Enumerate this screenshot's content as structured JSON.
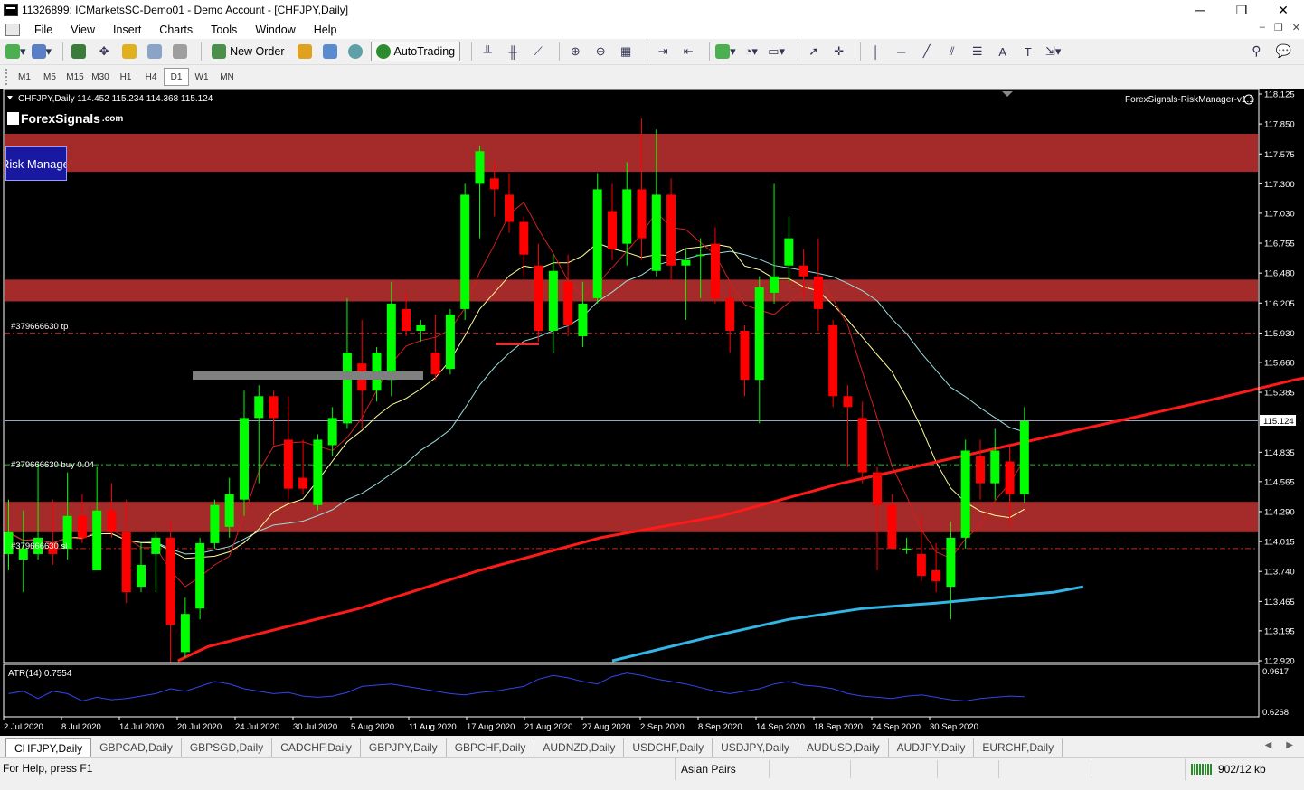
{
  "window": {
    "title": "11326899: ICMarketsSC-Demo01 - Demo Account - [CHFJPY,Daily]",
    "minimize": "─",
    "maximize": "❐",
    "close": "✕"
  },
  "menu": {
    "items": [
      "File",
      "View",
      "Insert",
      "Charts",
      "Tools",
      "Window",
      "Help"
    ],
    "mdi_minimize": "–",
    "mdi_restore": "❐",
    "mdi_close": "✕"
  },
  "toolbar": {
    "new_order_label": "New Order",
    "autotrading_label": "AutoTrading"
  },
  "timeframes": {
    "items": [
      "M1",
      "M5",
      "M15",
      "M30",
      "H1",
      "H4",
      "D1",
      "W1",
      "MN"
    ],
    "active": "D1"
  },
  "chart": {
    "header": "CHFJPY,Daily  114.452 115.234 114.368 115.124",
    "indicator_label": "ForexSignals-RiskManager-v1.1",
    "logo_text": "ForexSignals",
    "logo_suffix": ".com",
    "risk_manager_button": "Risk Manager",
    "tp_label": "#379666630 tp",
    "buy_label": "#379666630 buy 0.04",
    "sl_label": "#379666630 sl",
    "current_price": "115.124",
    "atr_label": "ATR(14) 0.7554",
    "colors": {
      "bull": "#00ff00",
      "bear": "#ff0000",
      "zone": "#a52a2a",
      "ma_slow": "#ff1a1a",
      "ma_200": "#33b5e5",
      "ma_fast_yellow": "#ffff99",
      "ma_mid_cyan": "#99dddd"
    }
  },
  "chart_data": {
    "type": "candlestick",
    "symbol": "CHFJPY",
    "timeframe": "Daily",
    "price_axis": [
      "118.125",
      "117.850",
      "117.575",
      "117.300",
      "117.030",
      "116.755",
      "116.480",
      "116.205",
      "115.930",
      "115.660",
      "115.385",
      "115.124",
      "114.835",
      "114.565",
      "114.290",
      "114.015",
      "113.740",
      "113.465",
      "113.195",
      "112.920"
    ],
    "atr_axis": [
      "0.9617",
      "0.6268"
    ],
    "date_axis": [
      "2 Jul 2020",
      "8 Jul 2020",
      "14 Jul 2020",
      "20 Jul 2020",
      "24 Jul 2020",
      "30 Jul 2020",
      "5 Aug 2020",
      "11 Aug 2020",
      "17 Aug 2020",
      "21 Aug 2020",
      "27 Aug 2020",
      "2 Sep 2020",
      "8 Sep 2020",
      "14 Sep 2020",
      "18 Sep 2020",
      "24 Sep 2020",
      "30 Sep 2020"
    ],
    "levels": {
      "tp": 115.93,
      "buy": 114.72,
      "sl": 113.95,
      "current": 115.124
    },
    "zones": [
      {
        "from": 117.41,
        "to": 117.76
      },
      {
        "from": 116.22,
        "to": 116.42
      },
      {
        "from": 114.1,
        "to": 114.38
      }
    ],
    "candles": [
      {
        "o": 113.9,
        "h": 114.4,
        "l": 113.75,
        "c": 114.1
      },
      {
        "o": 113.85,
        "h": 114.3,
        "l": 113.55,
        "c": 113.95
      },
      {
        "o": 113.9,
        "h": 114.75,
        "l": 113.85,
        "c": 114.05
      },
      {
        "o": 114.0,
        "h": 114.4,
        "l": 113.8,
        "c": 113.9
      },
      {
        "o": 113.95,
        "h": 114.65,
        "l": 113.85,
        "c": 114.25
      },
      {
        "o": 114.25,
        "h": 114.45,
        "l": 114.0,
        "c": 114.05
      },
      {
        "o": 113.75,
        "h": 114.7,
        "l": 113.8,
        "c": 114.3
      },
      {
        "o": 114.3,
        "h": 114.55,
        "l": 114.05,
        "c": 114.1
      },
      {
        "o": 114.1,
        "h": 114.4,
        "l": 113.45,
        "c": 113.55
      },
      {
        "o": 113.6,
        "h": 114.0,
        "l": 113.55,
        "c": 113.8
      },
      {
        "o": 113.9,
        "h": 114.1,
        "l": 113.55,
        "c": 114.05
      },
      {
        "o": 114.05,
        "h": 114.2,
        "l": 112.9,
        "c": 113.25
      },
      {
        "o": 113.0,
        "h": 113.5,
        "l": 112.95,
        "c": 113.35
      },
      {
        "o": 113.4,
        "h": 114.05,
        "l": 113.3,
        "c": 114.0
      },
      {
        "o": 114.0,
        "h": 114.4,
        "l": 113.95,
        "c": 114.35
      },
      {
        "o": 114.15,
        "h": 114.6,
        "l": 114.05,
        "c": 114.45
      },
      {
        "o": 114.4,
        "h": 115.4,
        "l": 114.25,
        "c": 115.15
      },
      {
        "o": 115.15,
        "h": 115.45,
        "l": 114.55,
        "c": 115.35
      },
      {
        "o": 115.35,
        "h": 115.4,
        "l": 114.9,
        "c": 115.15
      },
      {
        "o": 114.95,
        "h": 115.35,
        "l": 114.4,
        "c": 114.5
      },
      {
        "o": 114.6,
        "h": 114.95,
        "l": 114.45,
        "c": 114.5
      },
      {
        "o": 114.35,
        "h": 115.0,
        "l": 114.3,
        "c": 114.95
      },
      {
        "o": 114.9,
        "h": 115.25,
        "l": 114.8,
        "c": 115.15
      },
      {
        "o": 115.1,
        "h": 116.25,
        "l": 115.05,
        "c": 115.75
      },
      {
        "o": 115.65,
        "h": 116.05,
        "l": 115.05,
        "c": 115.4
      },
      {
        "o": 115.4,
        "h": 115.8,
        "l": 115.3,
        "c": 115.75
      },
      {
        "o": 115.5,
        "h": 116.4,
        "l": 115.35,
        "c": 116.2
      },
      {
        "o": 116.15,
        "h": 116.3,
        "l": 115.9,
        "c": 115.95
      },
      {
        "o": 115.95,
        "h": 116.05,
        "l": 115.85,
        "c": 116.0
      },
      {
        "o": 115.75,
        "h": 116.1,
        "l": 115.5,
        "c": 115.55
      },
      {
        "o": 115.6,
        "h": 116.15,
        "l": 115.55,
        "c": 116.1
      },
      {
        "o": 116.15,
        "h": 117.3,
        "l": 116.05,
        "c": 117.2
      },
      {
        "o": 117.3,
        "h": 117.65,
        "l": 116.8,
        "c": 117.6
      },
      {
        "o": 117.35,
        "h": 117.5,
        "l": 117.0,
        "c": 117.25
      },
      {
        "o": 117.2,
        "h": 117.4,
        "l": 116.85,
        "c": 116.95
      },
      {
        "o": 116.95,
        "h": 117.0,
        "l": 116.45,
        "c": 116.65
      },
      {
        "o": 116.55,
        "h": 116.75,
        "l": 115.85,
        "c": 115.95
      },
      {
        "o": 115.95,
        "h": 116.65,
        "l": 115.75,
        "c": 116.5
      },
      {
        "o": 116.4,
        "h": 116.65,
        "l": 115.9,
        "c": 116.0
      },
      {
        "o": 115.9,
        "h": 116.4,
        "l": 115.8,
        "c": 116.2
      },
      {
        "o": 116.25,
        "h": 117.4,
        "l": 116.2,
        "c": 117.25
      },
      {
        "o": 117.05,
        "h": 117.3,
        "l": 116.6,
        "c": 116.7
      },
      {
        "o": 116.75,
        "h": 117.5,
        "l": 116.55,
        "c": 117.25
      },
      {
        "o": 117.25,
        "h": 117.9,
        "l": 116.6,
        "c": 116.8
      },
      {
        "o": 116.5,
        "h": 117.8,
        "l": 116.45,
        "c": 117.2
      },
      {
        "o": 117.2,
        "h": 117.35,
        "l": 116.4,
        "c": 116.55
      },
      {
        "o": 116.55,
        "h": 116.7,
        "l": 116.05,
        "c": 116.6
      },
      {
        "o": 116.65,
        "h": 116.8,
        "l": 116.25,
        "c": 116.65
      },
      {
        "o": 116.75,
        "h": 116.9,
        "l": 116.2,
        "c": 116.25
      },
      {
        "o": 116.25,
        "h": 116.35,
        "l": 115.75,
        "c": 115.95
      },
      {
        "o": 115.95,
        "h": 116.0,
        "l": 115.35,
        "c": 115.5
      },
      {
        "o": 115.5,
        "h": 116.45,
        "l": 115.1,
        "c": 116.35
      },
      {
        "o": 116.3,
        "h": 117.3,
        "l": 116.2,
        "c": 116.45
      },
      {
        "o": 116.55,
        "h": 117.0,
        "l": 116.4,
        "c": 116.8
      },
      {
        "o": 116.55,
        "h": 116.7,
        "l": 116.25,
        "c": 116.45
      },
      {
        "o": 116.45,
        "h": 116.8,
        "l": 115.95,
        "c": 116.15
      },
      {
        "o": 116.0,
        "h": 116.05,
        "l": 115.25,
        "c": 115.35
      },
      {
        "o": 115.35,
        "h": 115.45,
        "l": 114.7,
        "c": 115.25
      },
      {
        "o": 115.15,
        "h": 115.3,
        "l": 114.55,
        "c": 114.65
      },
      {
        "o": 114.65,
        "h": 114.7,
        "l": 113.75,
        "c": 114.35
      },
      {
        "o": 114.35,
        "h": 114.45,
        "l": 113.95,
        "c": 113.95
      },
      {
        "o": 113.95,
        "h": 114.05,
        "l": 113.9,
        "c": 113.95
      },
      {
        "o": 113.9,
        "h": 114.25,
        "l": 113.65,
        "c": 113.7
      },
      {
        "o": 113.75,
        "h": 114.0,
        "l": 113.55,
        "c": 113.65
      },
      {
        "o": 113.6,
        "h": 114.2,
        "l": 113.3,
        "c": 114.05
      },
      {
        "o": 114.05,
        "h": 114.95,
        "l": 113.95,
        "c": 114.85
      },
      {
        "o": 114.8,
        "h": 114.95,
        "l": 114.4,
        "c": 114.55
      },
      {
        "o": 114.55,
        "h": 115.05,
        "l": 114.4,
        "c": 114.85
      },
      {
        "o": 114.75,
        "h": 114.9,
        "l": 114.15,
        "c": 114.45
      },
      {
        "o": 114.45,
        "h": 115.25,
        "l": 114.37,
        "c": 115.12
      }
    ],
    "ma_slow": [
      [
        30,
        112.92
      ],
      [
        31,
        113.05
      ],
      [
        36,
        113.4
      ],
      [
        40,
        113.75
      ],
      [
        44,
        114.05
      ],
      [
        48,
        114.25
      ],
      [
        52,
        114.55
      ],
      [
        56,
        114.8
      ],
      [
        60,
        115.05
      ],
      [
        64,
        115.3
      ],
      [
        67,
        115.5
      ],
      [
        69,
        115.6
      ],
      [
        71,
        115.65
      ],
      [
        72,
        115.62
      ],
      [
        74,
        115.55
      ],
      [
        76,
        115.4
      ],
      [
        78,
        115.3
      ],
      [
        80,
        115.2
      ]
    ],
    "ma_200": [
      [
        48,
        112.92
      ],
      [
        55,
        113.15
      ],
      [
        60,
        113.3
      ],
      [
        65,
        113.4
      ],
      [
        70,
        113.45
      ],
      [
        74,
        113.5
      ],
      [
        78,
        113.55
      ],
      [
        80,
        113.6
      ]
    ],
    "atr_series": [
      0.78,
      0.8,
      0.74,
      0.8,
      0.78,
      0.72,
      0.75,
      0.73,
      0.74,
      0.76,
      0.78,
      0.82,
      0.8,
      0.84,
      0.88,
      0.86,
      0.82,
      0.8,
      0.78,
      0.79,
      0.76,
      0.75,
      0.76,
      0.79,
      0.84,
      0.85,
      0.86,
      0.84,
      0.82,
      0.8,
      0.78,
      0.77,
      0.79,
      0.8,
      0.82,
      0.84,
      0.9,
      0.93,
      0.91,
      0.88,
      0.86,
      0.92,
      0.95,
      0.93,
      0.9,
      0.88,
      0.86,
      0.83,
      0.8,
      0.78,
      0.8,
      0.82,
      0.86,
      0.88,
      0.85,
      0.84,
      0.82,
      0.78,
      0.76,
      0.75,
      0.74,
      0.76,
      0.77,
      0.75,
      0.73,
      0.72,
      0.74,
      0.75,
      0.76,
      0.755
    ]
  },
  "symbol_tabs": {
    "items": [
      "CHFJPY,Daily",
      "GBPCAD,Daily",
      "GBPSGD,Daily",
      "CADCHF,Daily",
      "GBPJPY,Daily",
      "GBPCHF,Daily",
      "AUDNZD,Daily",
      "USDCHF,Daily",
      "USDJPY,Daily",
      "AUDUSD,Daily",
      "AUDJPY,Daily",
      "EURCHF,Daily"
    ],
    "active": "CHFJPY,Daily"
  },
  "status": {
    "help": "For Help, press F1",
    "profile": "Asian Pairs",
    "traffic": "902/12 kb"
  }
}
